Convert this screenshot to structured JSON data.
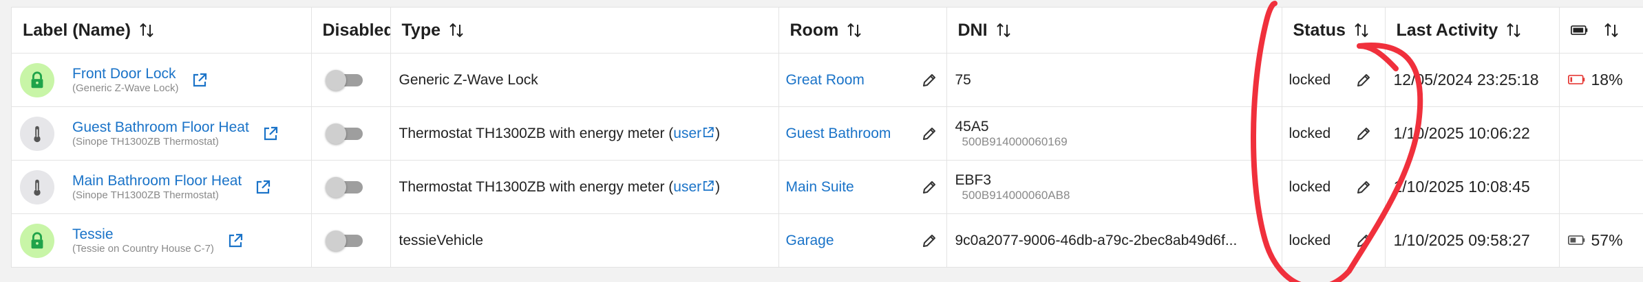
{
  "columns": [
    {
      "key": "label",
      "label": "Label (Name)"
    },
    {
      "key": "disabled",
      "label": "Disabled"
    },
    {
      "key": "type",
      "label": "Type"
    },
    {
      "key": "room",
      "label": "Room"
    },
    {
      "key": "dni",
      "label": "DNI"
    },
    {
      "key": "status",
      "label": "Status"
    },
    {
      "key": "last_activity",
      "label": "Last Activity"
    },
    {
      "key": "battery",
      "label": ""
    }
  ],
  "rows": [
    {
      "icon": "lock-icon",
      "name": "Front Door Lock",
      "subname": "(Generic Z-Wave Lock)",
      "type": "Generic Z-Wave Lock",
      "type_user": "",
      "room": "Great Room",
      "dni": "75",
      "dni_sub": "",
      "status": "locked",
      "last_activity": "12/05/2024 23:25:18",
      "battery": "18%",
      "battery_level": 0.18,
      "battery_color": "#e53935"
    },
    {
      "icon": "thermometer-icon",
      "name": "Guest Bathroom Floor Heat",
      "subname": "(Sinope TH1300ZB Thermostat)",
      "type": "Thermostat TH1300ZB with energy meter",
      "type_user": "user",
      "room": "Guest Bathroom",
      "dni": "45A5",
      "dni_sub": "500B914000060169",
      "status": "locked",
      "last_activity": "1/10/2025 10:06:22",
      "battery": "",
      "battery_level": null,
      "battery_color": ""
    },
    {
      "icon": "thermometer-icon",
      "name": "Main Bathroom Floor Heat",
      "subname": "(Sinope TH1300ZB Thermostat)",
      "type": "Thermostat TH1300ZB with energy meter",
      "type_user": "user",
      "room": "Main Suite",
      "dni": "EBF3",
      "dni_sub": "500B914000060AB8",
      "status": "locked",
      "last_activity": "1/10/2025 10:08:45",
      "battery": "",
      "battery_level": null,
      "battery_color": ""
    },
    {
      "icon": "lock-icon",
      "name": "Tessie",
      "subname": "(Tessie on Country House C-7)",
      "type": "tessieVehicle",
      "type_user": "",
      "room": "Garage",
      "dni": "9c0a2077-9006-46db-a79c-2bec8ab49d6f...",
      "dni_sub": "",
      "status": "locked",
      "last_activity": "1/10/2025 09:58:27",
      "battery": "57%",
      "battery_level": 0.57,
      "battery_color": "#555555"
    }
  ],
  "colors": {
    "link": "#1a73c8",
    "lock_bg": "#c8f5a7",
    "lock_icon": "#1fa34a",
    "annotation": "#f0303c"
  }
}
